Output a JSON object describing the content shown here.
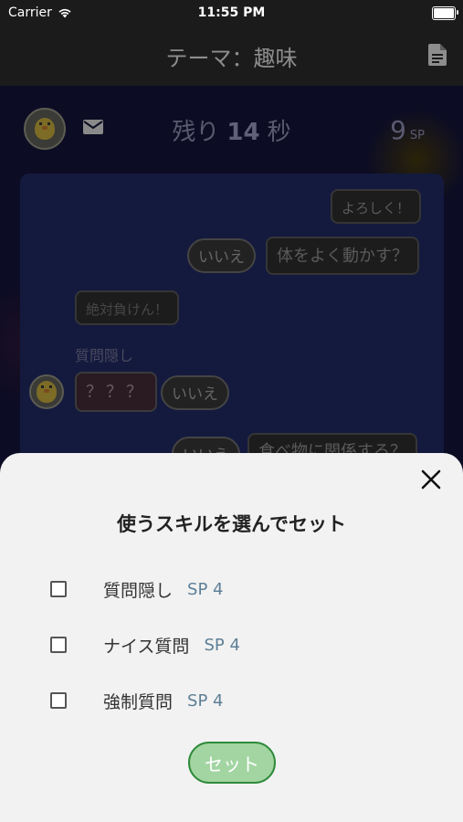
{
  "status_bar": {
    "carrier": "Carrier",
    "time": "11:55 PM"
  },
  "nav": {
    "title": "テーマ：趣味"
  },
  "game": {
    "timer_prefix": "残り",
    "timer_value": "14",
    "timer_suffix": "秒",
    "sp_value": "9",
    "sp_unit": "SP"
  },
  "chat": {
    "messages": [
      {
        "text": "よろしく！"
      },
      {
        "text": "いいえ"
      },
      {
        "text": "体をよく動かす？"
      },
      {
        "text": "絶対負けん！"
      },
      {
        "text": "質問隠し"
      },
      {
        "text": "？？？"
      },
      {
        "text": "いいえ"
      },
      {
        "text": "いいえ"
      },
      {
        "text": "食べ物に関係する？"
      }
    ]
  },
  "sheet": {
    "title": "使うスキルを選んでセット",
    "skills": [
      {
        "name": "質問隠し",
        "cost": "SP 4",
        "checked": false
      },
      {
        "name": "ナイス質問",
        "cost": "SP 4",
        "checked": false
      },
      {
        "name": "強制質問",
        "cost": "SP 4",
        "checked": false
      }
    ],
    "set_label": "セット"
  }
}
